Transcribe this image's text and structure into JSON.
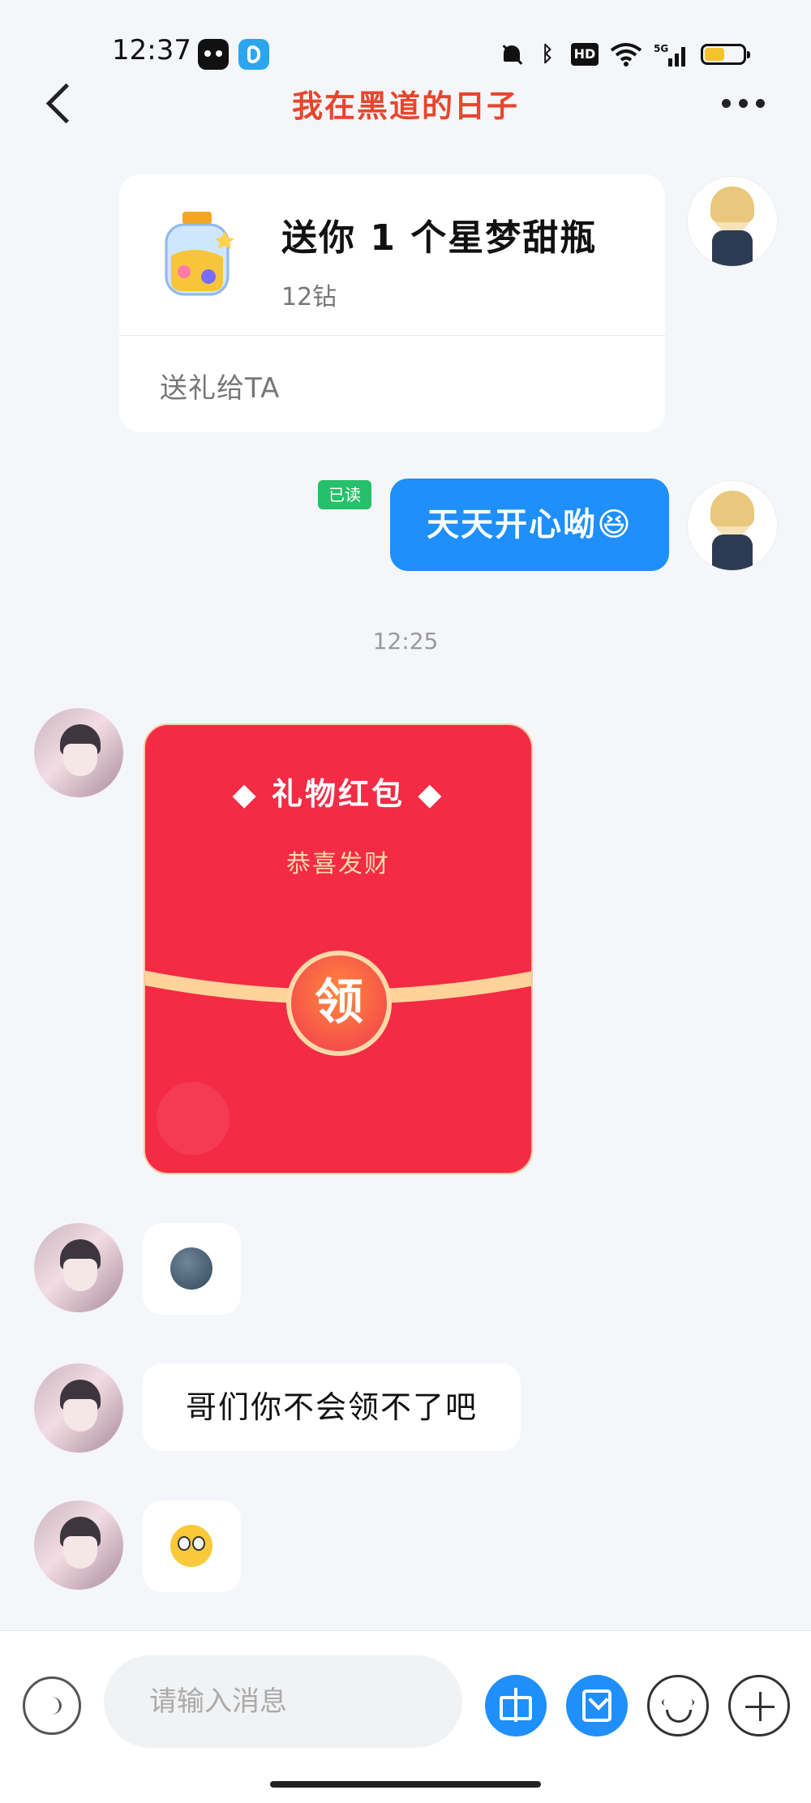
{
  "status_bar": {
    "time": "12:37",
    "network": "5G"
  },
  "header": {
    "title": "我在黑道的日子"
  },
  "gift_card": {
    "title": "送你 1 个星梦甜瓶",
    "price": "12钻",
    "action": "送礼给TA"
  },
  "outgoing_message": {
    "read_status": "已读",
    "text": "天天开心呦😆"
  },
  "timestamp": "12:25",
  "red_packet": {
    "title": "◆ 礼物红包 ◆",
    "subtitle": "恭喜发财",
    "claim_label": "领"
  },
  "incoming_messages": [
    {
      "type": "emoji",
      "content": "🌚"
    },
    {
      "type": "text",
      "content": "哥们你不会领不了吧"
    },
    {
      "type": "emoji",
      "content": "😳"
    }
  ],
  "input": {
    "placeholder": "请输入消息"
  },
  "colors": {
    "accent_blue": "#1e8ffb",
    "title_red": "#e8452d",
    "packet_red": "#f32b45",
    "read_green": "#27c06a"
  }
}
